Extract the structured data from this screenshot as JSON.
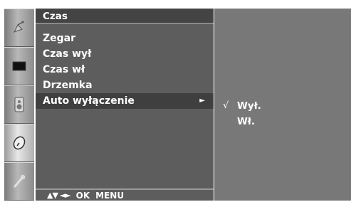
{
  "menu": {
    "title": "Czas",
    "items": [
      {
        "label": "Zegar"
      },
      {
        "label": "Czas wył"
      },
      {
        "label": "Czas wł"
      },
      {
        "label": "Drzemka"
      },
      {
        "label": "Auto wyłączenie",
        "arrow": "►"
      }
    ]
  },
  "submenu": {
    "check_mark": "√",
    "options": [
      {
        "label": "Wył."
      },
      {
        "label": "Wł."
      }
    ]
  },
  "footer": {
    "nav_arrows": "▲▼ ◄►",
    "ok": "OK",
    "menu": "MENU"
  },
  "icons": [
    "satellite-dish-icon",
    "picture-icon",
    "speaker-icon",
    "clock-icon",
    "wrench-icon"
  ],
  "colors": {
    "menu_bg": "#5d5d5d",
    "selected_bg": "#3f3f3f",
    "submenu_bg": "#787878",
    "text": "#ffffff"
  }
}
